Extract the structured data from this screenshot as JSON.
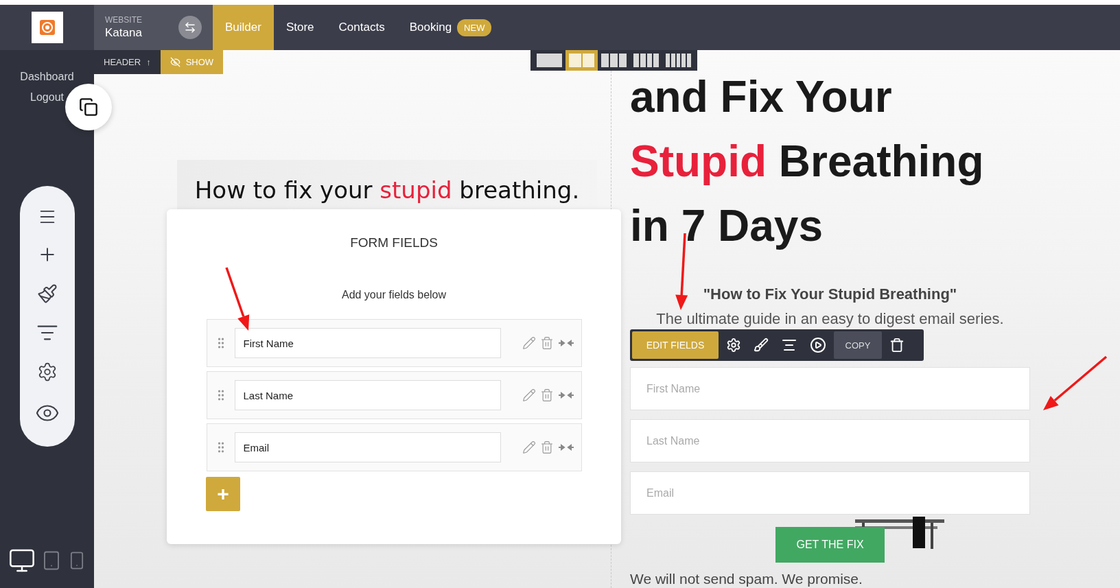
{
  "top_bar": {
    "website_label": "WEBSITE",
    "website_name": "Katana",
    "tabs": [
      {
        "label": "Builder",
        "selected": true
      },
      {
        "label": "Store",
        "selected": false
      },
      {
        "label": "Contacts",
        "selected": false
      },
      {
        "label": "Booking",
        "selected": false,
        "badge": "NEW"
      }
    ]
  },
  "sidebar": {
    "links": [
      "Dashboard",
      "Logout"
    ],
    "devices": [
      {
        "kind": "desktop",
        "selected": true
      },
      {
        "kind": "tablet",
        "selected": false
      },
      {
        "kind": "phone",
        "selected": false
      }
    ]
  },
  "section_bar": {
    "label": "HEADER",
    "arrow": "↑",
    "show_button": "SHOW"
  },
  "column_layouts": [
    {
      "kind": "one",
      "selected": false
    },
    {
      "kind": "two",
      "selected": true
    },
    {
      "kind": "three",
      "selected": false
    },
    {
      "kind": "four",
      "selected": false
    },
    {
      "kind": "five",
      "selected": false
    }
  ],
  "left_heading": [
    {
      "text": "How to fix your ",
      "highlight": false
    },
    {
      "text": "stupid",
      "highlight": true
    },
    {
      "text": " breathing.",
      "highlight": false
    }
  ],
  "form_fields_panel": {
    "title": "FORM FIELDS",
    "subtitle": "Add your fields below",
    "fields": [
      {
        "value": "First Name"
      },
      {
        "value": "Last Name"
      },
      {
        "value": "Email"
      }
    ],
    "add_button": "+"
  },
  "right_heading": [
    [
      {
        "text": "and Fix Your",
        "highlight": false
      }
    ],
    [
      {
        "text": "Stupid",
        "highlight": true
      },
      {
        "text": " Breathing",
        "highlight": false
      }
    ],
    [
      {
        "text": "in 7 Days",
        "highlight": false
      }
    ]
  ],
  "subtitle": "\"How to Fix Your Stupid Breathing\"",
  "tagline": "The ultimate guide in an easy to digest email series.",
  "element_toolbar": {
    "edit_button": "EDIT FIELDS",
    "copy_button": "COPY"
  },
  "signup_form": {
    "fields": [
      {
        "placeholder": "First Name"
      },
      {
        "placeholder": "Last Name"
      },
      {
        "placeholder": "Email"
      }
    ],
    "submit": "GET THE FIX",
    "note": "We will not send spam. We promise."
  }
}
